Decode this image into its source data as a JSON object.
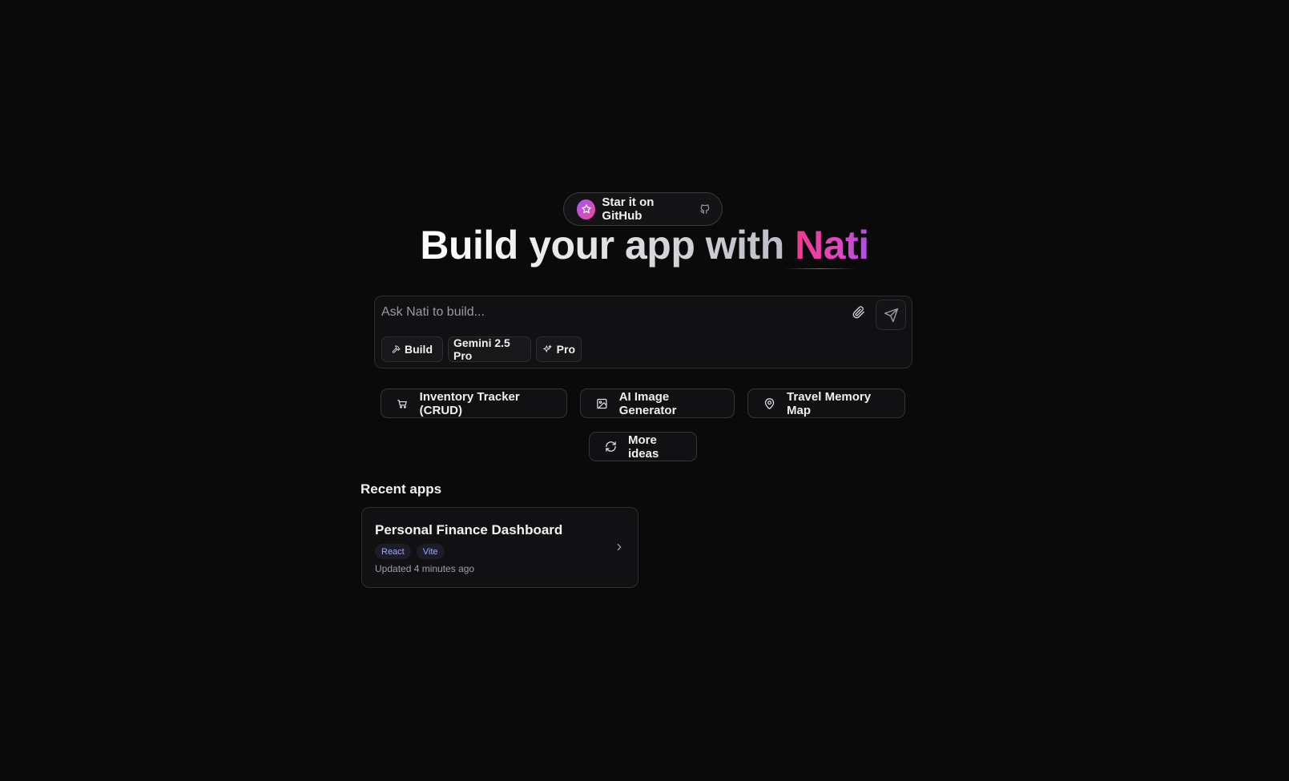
{
  "github": {
    "label": "Star it on GitHub"
  },
  "heading": {
    "prefix": "Build your app with ",
    "brand": "Nati"
  },
  "prompt": {
    "placeholder": "Ask Nati to build...",
    "chips": {
      "mode": "Build",
      "model": "Gemini 2.5 Pro",
      "tier": "Pro"
    }
  },
  "ideas": {
    "items": [
      {
        "label": "Inventory Tracker (CRUD)",
        "icon": "cart-icon"
      },
      {
        "label": "AI Image Generator",
        "icon": "image-icon"
      },
      {
        "label": "Travel Memory Map",
        "icon": "map-pin-icon"
      }
    ],
    "more_label": "More ideas"
  },
  "recent": {
    "title": "Recent apps",
    "apps": [
      {
        "name": "Personal Finance Dashboard",
        "tags": [
          "React",
          "Vite"
        ],
        "updated": "Updated 4 minutes ago"
      }
    ]
  },
  "colors": {
    "background": "#0a0a0a",
    "brand_start": "#f0388a",
    "brand_end": "#b04ee8",
    "tag_text": "#a5a8ff"
  }
}
